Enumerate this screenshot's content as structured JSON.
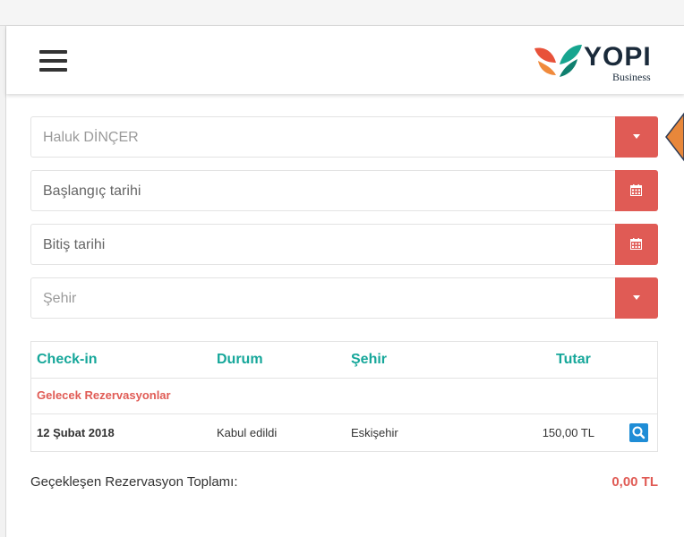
{
  "header": {
    "logo_text": "YOPI",
    "logo_sub": "Business"
  },
  "filters": [
    {
      "placeholder": "Haluk DİNÇER",
      "icon": "chevron-down-icon"
    },
    {
      "placeholder": "Başlangıç tarihi",
      "icon": "calendar-icon"
    },
    {
      "placeholder": "Bitiş tarihi",
      "icon": "calendar-icon"
    },
    {
      "placeholder": "Şehir",
      "icon": "chevron-down-icon"
    }
  ],
  "table": {
    "columns": [
      "Check-in",
      "Durum",
      "Şehir",
      "Tutar"
    ],
    "group_label": "Gelecek Rezervasyonlar",
    "rows": [
      {
        "checkin": "12 Şubat 2018",
        "status": "Kabul edildi",
        "city": "Eskişehir",
        "amount": "150,00 TL"
      }
    ]
  },
  "summary": {
    "label": "Geçekleşen Rezervasyon Toplamı:",
    "value": "0,00 TL"
  },
  "colors": {
    "accent_red": "#e05b55",
    "accent_teal": "#16a79a",
    "search_blue": "#1f8dd6",
    "pointer_orange": "#e8873a"
  }
}
